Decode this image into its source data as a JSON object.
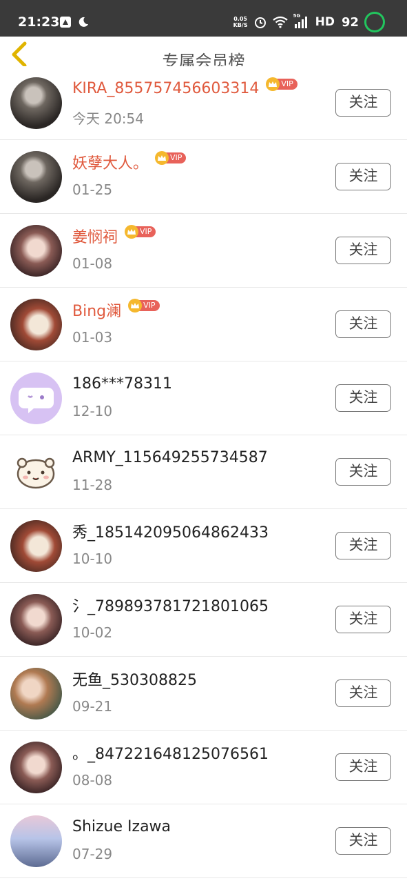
{
  "status_bar": {
    "time": "21:23",
    "speed_value": "0.05",
    "speed_unit": "KB/S",
    "network": "5G",
    "hd": "HD",
    "battery": "92"
  },
  "nav": {
    "title": "专属会员榜"
  },
  "vip_label": "VIP",
  "follow_label": "关注",
  "colors": {
    "vip_name": "#e05a3e",
    "vip_badge": "#e8625a",
    "crown": "#f5b82e",
    "back_arrow": "#e0b400",
    "battery_ring": "#22c55e"
  },
  "members": [
    {
      "name": "KIRA_855757456603314",
      "date": "今天 20:54",
      "vip": true,
      "avatar": "photo-dark-avatar"
    },
    {
      "name": "妖孽大人。",
      "date": "01-25",
      "vip": true,
      "avatar": "photo-dark-avatar"
    },
    {
      "name": "姜悯祠",
      "date": "01-08",
      "vip": true,
      "avatar": "illustrated-girl-avatar"
    },
    {
      "name": "Bing澜",
      "date": "01-03",
      "vip": true,
      "avatar": "anime-girl-avatar"
    },
    {
      "name": "186***78311",
      "date": "12-10",
      "vip": false,
      "avatar": "chat-bubble-avatar"
    },
    {
      "name": "ARMY_115649255734587",
      "date": "11-28",
      "vip": false,
      "avatar": "cartoon-bear-avatar"
    },
    {
      "name": "秀_185142095064862433",
      "date": "10-10",
      "vip": false,
      "avatar": "anime-girl-avatar"
    },
    {
      "name": "氵_789893781721801065",
      "date": "10-02",
      "vip": false,
      "avatar": "illustrated-girl-avatar"
    },
    {
      "name": "无鱼_530308825",
      "date": "09-21",
      "vip": false,
      "avatar": "photo-avatar"
    },
    {
      "name": "。_847221648125076561",
      "date": "08-08",
      "vip": false,
      "avatar": "illustrated-girl-avatar"
    },
    {
      "name": "Shizue Izawa",
      "date": "07-29",
      "vip": false,
      "avatar": "scenery-avatar"
    }
  ]
}
